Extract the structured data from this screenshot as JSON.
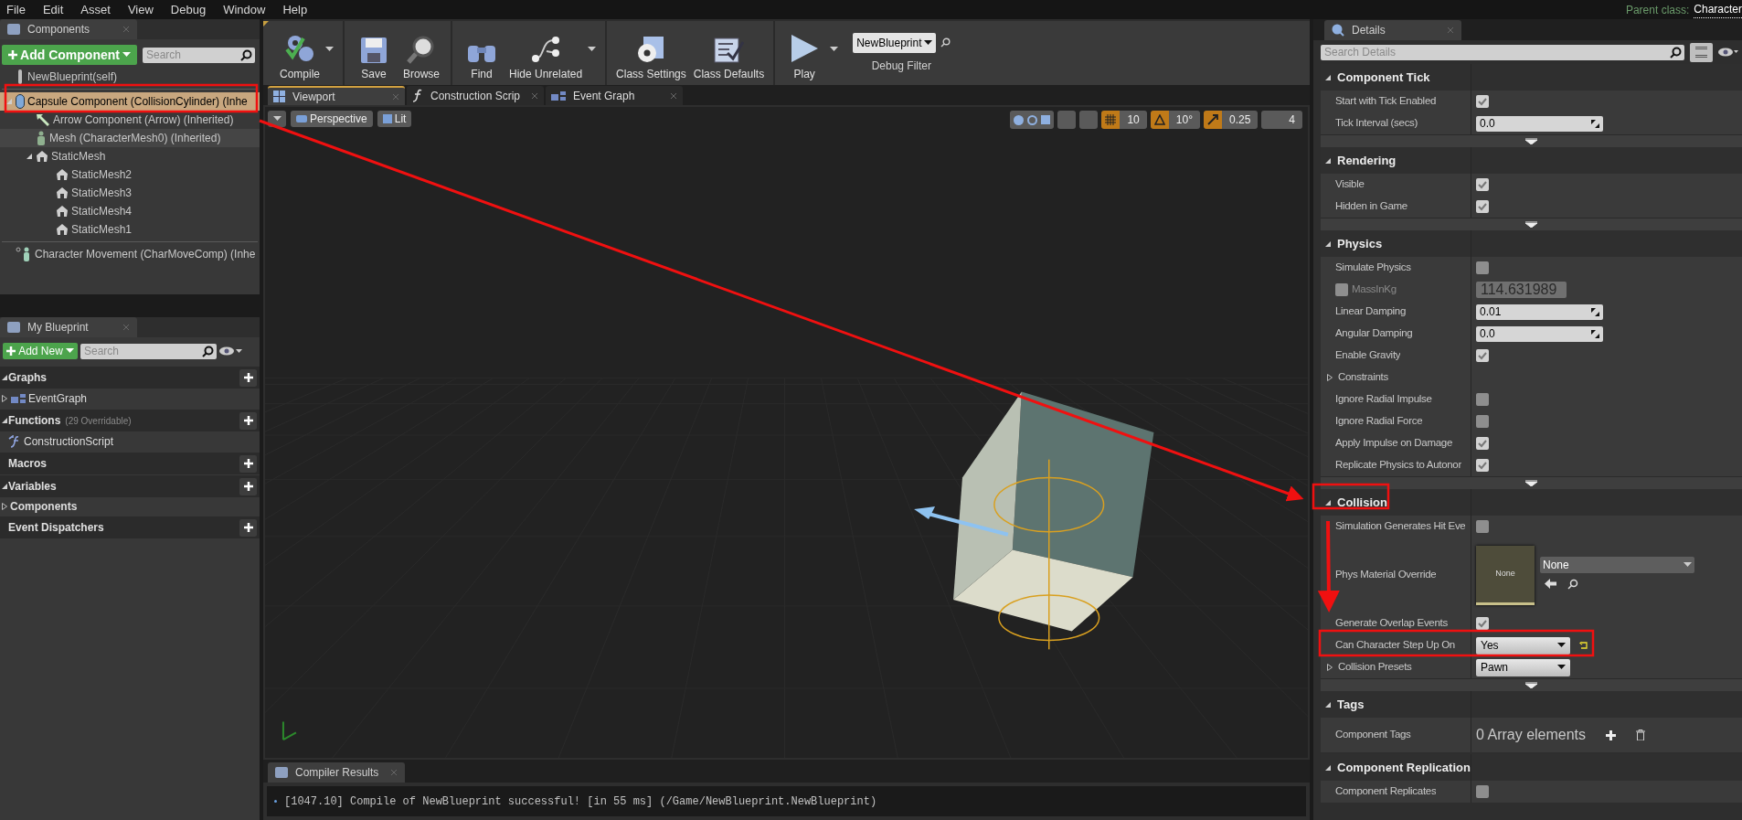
{
  "menu": [
    "File",
    "Edit",
    "Asset",
    "View",
    "Debug",
    "Window",
    "Help"
  ],
  "parent_class": {
    "label": "Parent class:",
    "value": "Character"
  },
  "components": {
    "tab": "Components",
    "add_button": "Add Component",
    "search": {
      "placeholder": "Search"
    },
    "tree": [
      {
        "label": "NewBlueprint(self)",
        "kind": "self",
        "selected": false
      },
      {
        "label": "Capsule Component (CollisionCylinder) (Inhe",
        "kind": "capsule",
        "selected": true,
        "expanded": true,
        "children": [
          {
            "label": "Arrow Component (Arrow) (Inherited)",
            "kind": "arrow",
            "selected": false
          },
          {
            "label": "Mesh (CharacterMesh0) (Inherited)",
            "kind": "mesh",
            "selected": false,
            "highlighted": true
          },
          {
            "label": "StaticMesh",
            "kind": "static",
            "selected": false,
            "expanded": true,
            "children": [
              {
                "label": "StaticMesh2",
                "kind": "static",
                "selected": false
              },
              {
                "label": "StaticMesh3",
                "kind": "static",
                "selected": false
              },
              {
                "label": "StaticMesh4",
                "kind": "static",
                "selected": false
              },
              {
                "label": "StaticMesh1",
                "kind": "static",
                "selected": false
              }
            ]
          }
        ]
      },
      {
        "label": "Character Movement (CharMoveComp) (Inhe",
        "kind": "movement",
        "selected": false
      }
    ]
  },
  "my_blueprint": {
    "tab": "My Blueprint",
    "add_button": "Add New",
    "search": {
      "placeholder": "Search"
    },
    "sections": [
      {
        "title": "Graphs",
        "expanded": true,
        "items": [
          {
            "label": "EventGraph",
            "kind": "graph"
          }
        ]
      },
      {
        "title": "Functions",
        "note": "(29 Overridable)",
        "expanded": true,
        "items": [
          {
            "label": "ConstructionScript",
            "kind": "function"
          }
        ]
      },
      {
        "title": "Macros"
      },
      {
        "title": "Variables",
        "expanded": true,
        "items": [
          {
            "label": "Components",
            "kind": "category"
          }
        ]
      },
      {
        "title": "Event Dispatchers"
      }
    ]
  },
  "toolbar": [
    [
      {
        "label": "Compile",
        "kind": "compile",
        "menu": true
      }
    ],
    [
      {
        "label": "Save",
        "kind": "save",
        "menu": false
      },
      {
        "label": "Browse",
        "kind": "browse",
        "menu": false
      }
    ],
    [
      {
        "label": "Find",
        "kind": "find",
        "menu": false
      },
      {
        "label": "Hide Unrelated",
        "kind": "hide",
        "menu": true
      }
    ],
    [
      {
        "label": "Class Settings",
        "kind": "settings",
        "menu": false
      },
      {
        "label": "Class Defaults",
        "kind": "defaults",
        "menu": false
      }
    ],
    [
      {
        "label": "Play",
        "kind": "play",
        "menu": true
      }
    ]
  ],
  "debug_filter": {
    "value": "NewBlueprint",
    "label": "Debug Filter"
  },
  "editor_tabs": [
    {
      "label": "Viewport",
      "kind": "viewport",
      "selected": true
    },
    {
      "label": "Construction Scrip",
      "kind": "function",
      "selected": false
    },
    {
      "label": "Event Graph",
      "kind": "graph",
      "selected": false
    }
  ],
  "viewport": {
    "view_button": "Perspective",
    "mode_button": "Lit",
    "snaps": [
      {
        "kind": "grid",
        "value": "10",
        "on": true
      },
      {
        "kind": "angle",
        "value": "10°",
        "on": true
      },
      {
        "kind": "scale",
        "value": "0.25",
        "on": true
      }
    ],
    "camera_speed": "4"
  },
  "compiler": {
    "tab": "Compiler Results",
    "message": "[1047.10] Compile of NewBlueprint successful! [in 55 ms] (/Game/NewBlueprint.NewBlueprint)"
  },
  "details": {
    "tab": "Details",
    "search": {
      "placeholder": "Search Details"
    },
    "sections": [
      {
        "title": "Component Tick",
        "advanced": true,
        "rows": [
          {
            "kind": "checkbox",
            "label": "Start with Tick Enabled",
            "checked": true
          },
          {
            "kind": "number",
            "label": "Tick Interval (secs)",
            "value": "0.0"
          }
        ]
      },
      {
        "title": "Rendering",
        "advanced": true,
        "rows": [
          {
            "kind": "checkbox",
            "label": "Visible",
            "checked": true
          },
          {
            "kind": "checkbox",
            "label": "Hidden in Game",
            "checked": true
          }
        ]
      },
      {
        "title": "Physics",
        "advanced": true,
        "rows": [
          {
            "kind": "checkbox",
            "label": "Simulate Physics",
            "checked": false
          },
          {
            "kind": "mass",
            "label": "MassInKg",
            "checked": false,
            "value": "114.631989",
            "disabled": true
          },
          {
            "kind": "number",
            "label": "Linear Damping",
            "value": "0.01"
          },
          {
            "kind": "number",
            "label": "Angular Damping",
            "value": "0.0"
          },
          {
            "kind": "checkbox",
            "label": "Enable Gravity",
            "checked": true
          },
          {
            "kind": "group",
            "label": "Constraints",
            "expanded": false
          },
          {
            "kind": "checkbox",
            "label": "Ignore Radial Impulse",
            "checked": false
          },
          {
            "kind": "checkbox",
            "label": "Ignore Radial Force",
            "checked": false
          },
          {
            "kind": "checkbox",
            "label": "Apply Impulse on Damage",
            "checked": true
          },
          {
            "kind": "checkbox",
            "label": "Replicate Physics to Autonor",
            "checked": true
          }
        ]
      },
      {
        "title": "Collision",
        "advanced": true,
        "rows": [
          {
            "kind": "checkbox",
            "label": "Simulation Generates Hit Eve",
            "checked": false
          },
          {
            "kind": "material",
            "label": "Phys Material Override",
            "thumb": "None",
            "value": "None"
          },
          {
            "kind": "checkbox",
            "label": "Generate Overlap Events",
            "checked": true
          },
          {
            "kind": "dropdown",
            "label": "Can Character Step Up On",
            "value": "Yes",
            "reset": true,
            "expandable": false
          },
          {
            "kind": "dropdown",
            "label": "Collision Presets",
            "value": "Pawn",
            "reset": false,
            "expandable": true
          }
        ]
      },
      {
        "title": "Tags",
        "advanced": false,
        "rows": [
          {
            "kind": "array",
            "label": "Component Tags",
            "value": "0 Array elements"
          }
        ]
      },
      {
        "title": "Component Replication",
        "advanced": false,
        "rows": [
          {
            "kind": "checkbox",
            "label": "Component Replicates",
            "checked": false
          }
        ]
      }
    ]
  }
}
